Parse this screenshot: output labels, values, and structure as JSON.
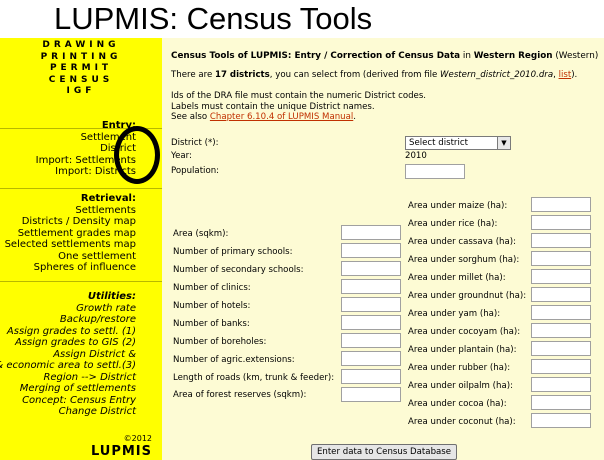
{
  "page_title": "LUPMIS: Census Tools",
  "sidebar": {
    "top_items": [
      "DRAWING",
      "PRINTING",
      "PERMIT",
      "CENSUS",
      "IGF"
    ],
    "entry": {
      "heading": "Entry:",
      "items": [
        "Settlement",
        "District",
        "Import: Settlements",
        "Import: Districts"
      ]
    },
    "retrieval": {
      "heading": "Retrieval:",
      "items": [
        "Settlements",
        "Districts / Density map",
        "Settlement grades map",
        "Selected settlements map",
        "One settlement",
        "Spheres of influence"
      ]
    },
    "utilities": {
      "heading": "Utilities:",
      "items": [
        "Growth rate",
        "Backup/restore",
        "Assign grades to settl. (1)",
        "Assign grades to GIS (2)",
        "Assign District &",
        "& economic area to settl.(3)",
        "Region --> District",
        "Merging of settlements",
        "Concept: Census Entry",
        "Change District"
      ]
    },
    "copyright": "©2012",
    "brand": "LUPMIS"
  },
  "main": {
    "heading_bold": "Census Tools of LUPMIS: Entry / Correction of Census Data",
    "heading_in": " in ",
    "heading_region": "Western Region",
    "heading_region_paren": " (Western)",
    "line2_a": "There are ",
    "line2_count": "17 districts",
    "line2_b": ", you can select from (derived from file ",
    "line2_file": "Western_district_2010.dra",
    "line2_c": ", ",
    "line2_link": "list",
    "line2_d": ").",
    "info1": "Ids of the DRA file must contain the numeric District codes.",
    "info2": "Labels must contain the unique District names.",
    "info3_a": "See also ",
    "info3_link": "Chapter 6.10.4 of LUPMIS Manual",
    "info3_b": ".",
    "district_label": "District (*):",
    "district_select": "Select district",
    "year_label": "Year:",
    "year_value": "2010",
    "population_label": "Population:",
    "left_fields": [
      "Area (sqkm):",
      "Number of primary schools:",
      "Number of secondary schools:",
      "Number of clinics:",
      "Number of hotels:",
      "Number of banks:",
      "Number of boreholes:",
      "Number of agric.extensions:",
      "Length of roads (km, trunk & feeder):",
      "Area of forest reserves (sqkm):"
    ],
    "right_fields": [
      "Area under maize (ha):",
      "Area under rice (ha):",
      "Area under cassava (ha):",
      "Area under sorghum (ha):",
      "Area under millet (ha):",
      "Area under groundnut (ha):",
      "Area under yam (ha):",
      "Area under cocoyam (ha):",
      "Area under plantain (ha):",
      "Area under rubber (ha):",
      "Area under oilpalm (ha):",
      "Area under cocoa (ha):",
      "Area under coconut (ha):"
    ],
    "submit_label": "Enter data to Census Database"
  },
  "colors": {
    "sidebar": "#ffff00",
    "main_bg": "#fdfbd4",
    "link": "#c03000"
  }
}
